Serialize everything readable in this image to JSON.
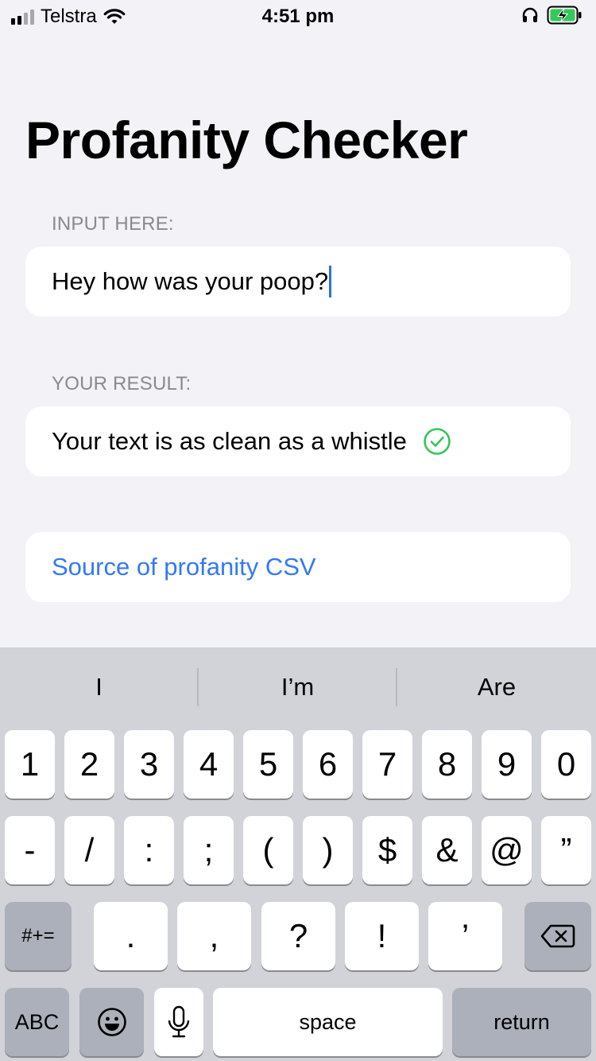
{
  "status_bar": {
    "carrier": "Telstra",
    "time": "4:51 pm"
  },
  "page": {
    "title": "Profanity Checker",
    "input_section": {
      "label": "INPUT HERE:",
      "value": "Hey how was your poop?"
    },
    "result_section": {
      "label": "YOUR RESULT:",
      "value": "Your text is as clean as a whistle",
      "status_icon": "checkmark-circle-icon",
      "status_color": "#34c759"
    },
    "source_link": {
      "label": "Source of profanity CSV",
      "color": "#3478f6"
    }
  },
  "keyboard": {
    "suggestions": [
      "I",
      "I’m",
      "Are"
    ],
    "row1": [
      "1",
      "2",
      "3",
      "4",
      "5",
      "6",
      "7",
      "8",
      "9",
      "0"
    ],
    "row2": [
      "-",
      "/",
      ":",
      ";",
      "(",
      ")",
      "$",
      "&",
      "@",
      "”"
    ],
    "row3": {
      "shift_label": "#+=",
      "keys": [
        ".",
        ",",
        "?",
        "!",
        "’"
      ],
      "delete_icon": "delete-backward-icon"
    },
    "row4": {
      "abc_label": "ABC",
      "emoji_icon": "emoji-icon",
      "mic_icon": "microphone-icon",
      "space_label": "space",
      "return_label": "return"
    }
  }
}
